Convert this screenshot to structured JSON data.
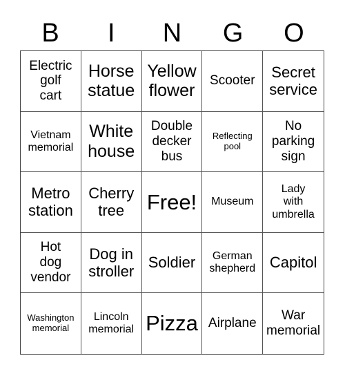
{
  "header": {
    "letters": [
      "B",
      "I",
      "N",
      "G",
      "O"
    ]
  },
  "grid": {
    "rows": [
      [
        "Electric\ngolf\ncart",
        "Horse\nstatue",
        "Yellow\nflower",
        "Scooter",
        "Secret\nservice"
      ],
      [
        "Vietnam\nmemorial",
        "White\nhouse",
        "Double\ndecker\nbus",
        "Reflecting\npool",
        "No\nparking\nsign"
      ],
      [
        "Metro\nstation",
        "Cherry\ntree",
        "Free!",
        "Museum",
        "Lady\nwith\numbrella"
      ],
      [
        "Hot\ndog\nvendor",
        "Dog in\nstroller",
        "Soldier",
        "German\nshepherd",
        "Capitol"
      ],
      [
        "Washington\nmemorial",
        "Lincoln\nmemorial",
        "Pizza",
        "Airplane",
        "War\nmemorial"
      ]
    ],
    "free_space": "Free!"
  }
}
